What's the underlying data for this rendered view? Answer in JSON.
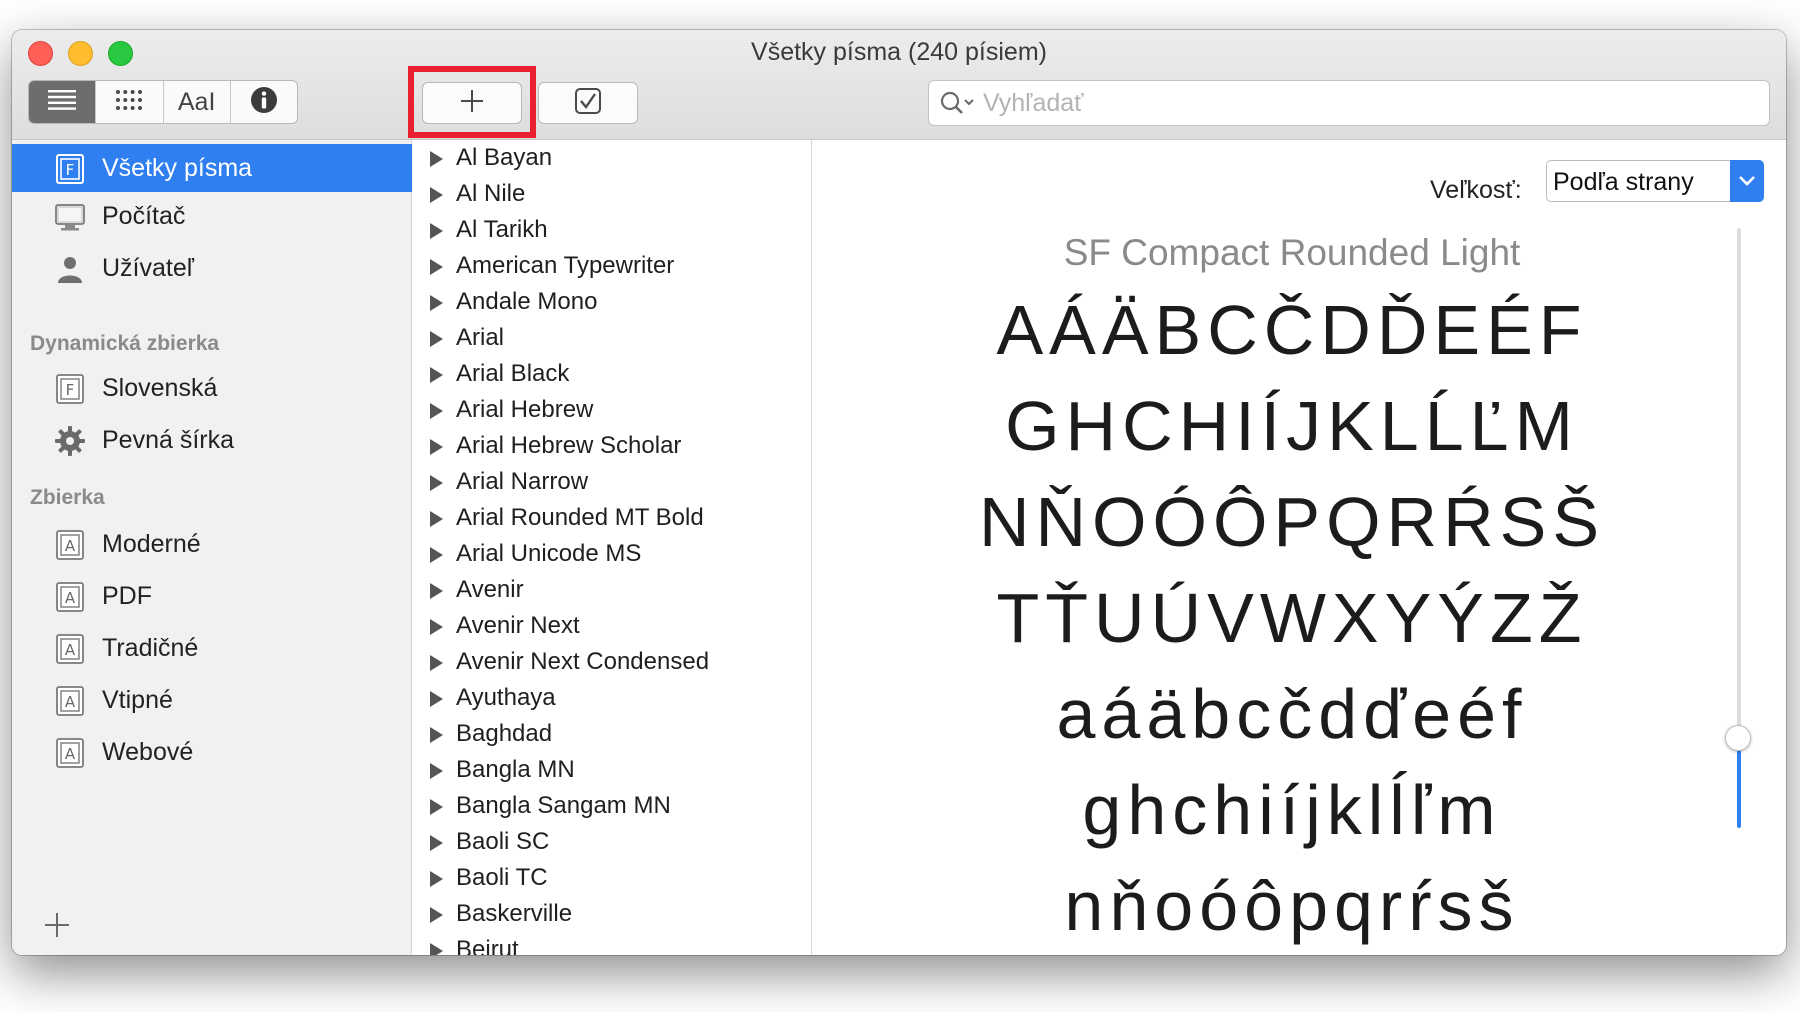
{
  "window": {
    "title": "Všetky písma (240 písiem)"
  },
  "toolbar": {
    "view_modes": [
      {
        "name": "list-view",
        "icon": "lines-icon",
        "active": true
      },
      {
        "name": "grid-view",
        "icon": "grid-icon",
        "active": false
      },
      {
        "name": "sample-view",
        "icon": "sample-text-icon",
        "label": "AaI",
        "active": false
      },
      {
        "name": "info-view",
        "icon": "info-icon",
        "active": false
      }
    ],
    "add_icon": "plus-icon",
    "validate_icon": "checkbox-icon",
    "highlight_color": "#e8202f"
  },
  "search": {
    "placeholder": "Vyhľadať",
    "value": ""
  },
  "sidebar": {
    "items": [
      {
        "label": "Všetky písma",
        "icon": "font-book-icon",
        "selected": true
      },
      {
        "label": "Počítač",
        "icon": "computer-icon"
      },
      {
        "label": "Užívateľ",
        "icon": "user-icon"
      }
    ],
    "dynamic_header": "Dynamická zbierka",
    "dynamic_items": [
      {
        "label": "Slovenská",
        "icon": "font-book-icon"
      },
      {
        "label": "Pevná šírka",
        "icon": "gear-icon"
      }
    ],
    "collection_header": "Zbierka",
    "collection_items": [
      {
        "label": "Moderné",
        "icon": "collection-icon"
      },
      {
        "label": "PDF",
        "icon": "collection-icon"
      },
      {
        "label": "Tradičné",
        "icon": "collection-icon"
      },
      {
        "label": "Vtipné",
        "icon": "collection-icon"
      },
      {
        "label": "Webové",
        "icon": "collection-icon"
      }
    ],
    "add_icon": "plus-icon"
  },
  "font_list": [
    "Al Bayan",
    "Al Nile",
    "Al Tarikh",
    "American Typewriter",
    "Andale Mono",
    "Arial",
    "Arial Black",
    "Arial Hebrew",
    "Arial Hebrew Scholar",
    "Arial Narrow",
    "Arial Rounded MT Bold",
    "Arial Unicode MS",
    "Avenir",
    "Avenir Next",
    "Avenir Next Condensed",
    "Ayuthaya",
    "Baghdad",
    "Bangla MN",
    "Bangla Sangam MN",
    "Baoli SC",
    "Baoli TC",
    "Baskerville",
    "Beirut"
  ],
  "preview": {
    "size_label": "Veľkosť:",
    "size_value": "Podľa strany",
    "font_name": "SF Compact Rounded Light",
    "sample_lines": [
      "AÁÄBCČDĎEÉF",
      "GHCHIÍJKLĹĽM",
      "NŇOÓÔPQRŔSŠ",
      "TŤUÚVWXYÝZŽ",
      "aáäbcčdďeéf",
      "ghchiíjklĺľm",
      "nňoóôpqrŕsš"
    ],
    "zoom_level": 0.15
  },
  "colors": {
    "accent": "#2f7ff0",
    "sidebar_bg": "#f1f1f1"
  }
}
